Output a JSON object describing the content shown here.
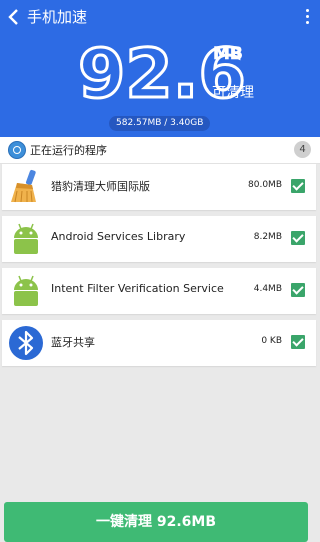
{
  "header": {
    "title": "手机加速",
    "big_value": "92.6",
    "unit": "MB",
    "clean_label": "可清理",
    "memory": "582.57MB / 3.40GB",
    "accent_color": "#2d6be4"
  },
  "process_section": {
    "title": "正在运行的程序",
    "count": "4"
  },
  "apps": [
    {
      "name": "猎豹清理大师国际版",
      "size": "80.0MB",
      "icon": "broom-icon",
      "checked": true
    },
    {
      "name": "Android Services Library",
      "size": "8.2MB",
      "icon": "android-icon",
      "checked": true
    },
    {
      "name": "Intent Filter Verification Service",
      "size": "4.4MB",
      "icon": "android-icon",
      "checked": true
    },
    {
      "name": "蓝牙共享",
      "size": "0 KB",
      "icon": "bluetooth-icon",
      "checked": true
    }
  ],
  "footer": {
    "clean_button": "一键清理 92.6MB",
    "button_color": "#3fba74"
  }
}
